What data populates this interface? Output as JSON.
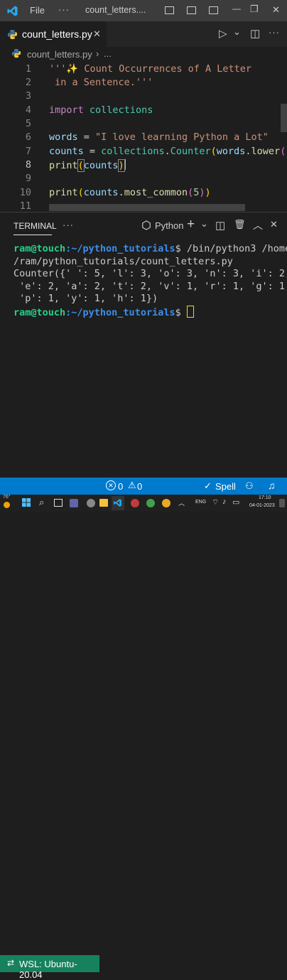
{
  "titlebar": {
    "menu_file": "File",
    "more": "···",
    "window_title": "count_letters....",
    "minimize": "—",
    "restore": "❐",
    "close": "✕"
  },
  "tabs": [
    {
      "label": "count_letters.py",
      "close": "✕"
    }
  ],
  "tab_actions": {
    "run": "▷",
    "run_dropdown": "⌄",
    "split": "◫",
    "more": "···"
  },
  "breadcrumb": {
    "file": "count_letters.py",
    "sep": "›",
    "more": "..."
  },
  "editor": {
    "line_numbers": [
      "1",
      "2",
      "3",
      "4",
      "5",
      "6",
      "7",
      "8",
      "9",
      "10",
      "11"
    ],
    "active_line": "8",
    "code": {
      "l1_doc": "'''✨ Count Occurrences of A Letter",
      "l2_doc": " in a Sentence.'''",
      "l4_import": "import",
      "l4_module": "collections",
      "l6_var": "words",
      "l6_eq": " = ",
      "l6_str": "\"I love learning Python a Lot\"",
      "l7_var": "counts",
      "l7_eq": " = ",
      "l7_mod": "collections",
      "l7_dot": ".",
      "l7_cls": "Counter",
      "l7_paren": "(",
      "l7_arg": "words",
      "l7_dot2": ".",
      "l7_fn": "lower",
      "l7_end": "()",
      "l8_fn": "print",
      "l8_open": "(",
      "l8_arg": "counts",
      "l8_close": ")",
      "l10_fn": "print",
      "l10_open": "(",
      "l10_arg": "counts",
      "l10_dot": ".",
      "l10_meth": "most_common",
      "l10_p1": "(",
      "l10_num": "5",
      "l10_p2": ")",
      "l10_close": ")"
    }
  },
  "panel": {
    "tab_terminal": "TERMINAL",
    "more": "···",
    "shell": "Python",
    "add": "+",
    "add_dropdown": "⌄",
    "split": "◫",
    "trash": "🗑",
    "maximize": "︿",
    "close": "✕"
  },
  "terminal": {
    "user1": "ram@touch",
    "path1": ":~/python_tutorials",
    "cmd1": "$ /bin/python3 /home",
    "cmd1b": "/ram/python_tutorials/count_letters.py",
    "out1": "Counter({' ': 5, 'l': 3, 'o': 3, 'n': 3, 'i': 2,",
    "out2": " 'e': 2, 'a': 2, 't': 2, 'v': 1, 'r': 1, 'g': 1,",
    "out3": " 'p': 1, 'y': 1, 'h': 1})",
    "user2": "ram@touch",
    "path2": ":~/python_tutorials",
    "prompt2": "$ "
  },
  "statusbar": {
    "remote": "WSL: Ubuntu-20.04",
    "errors": "0",
    "warnings": "0",
    "spell": "Spell"
  },
  "taskbar": {
    "temp": "76°",
    "lang": "ENG",
    "time": "17:10",
    "date": "04-01-2023"
  },
  "colors": {
    "statusbar": "#007acc",
    "remote": "#16825d",
    "accent_prompt_user": "#23d18b",
    "accent_prompt_path": "#3b8eea"
  }
}
